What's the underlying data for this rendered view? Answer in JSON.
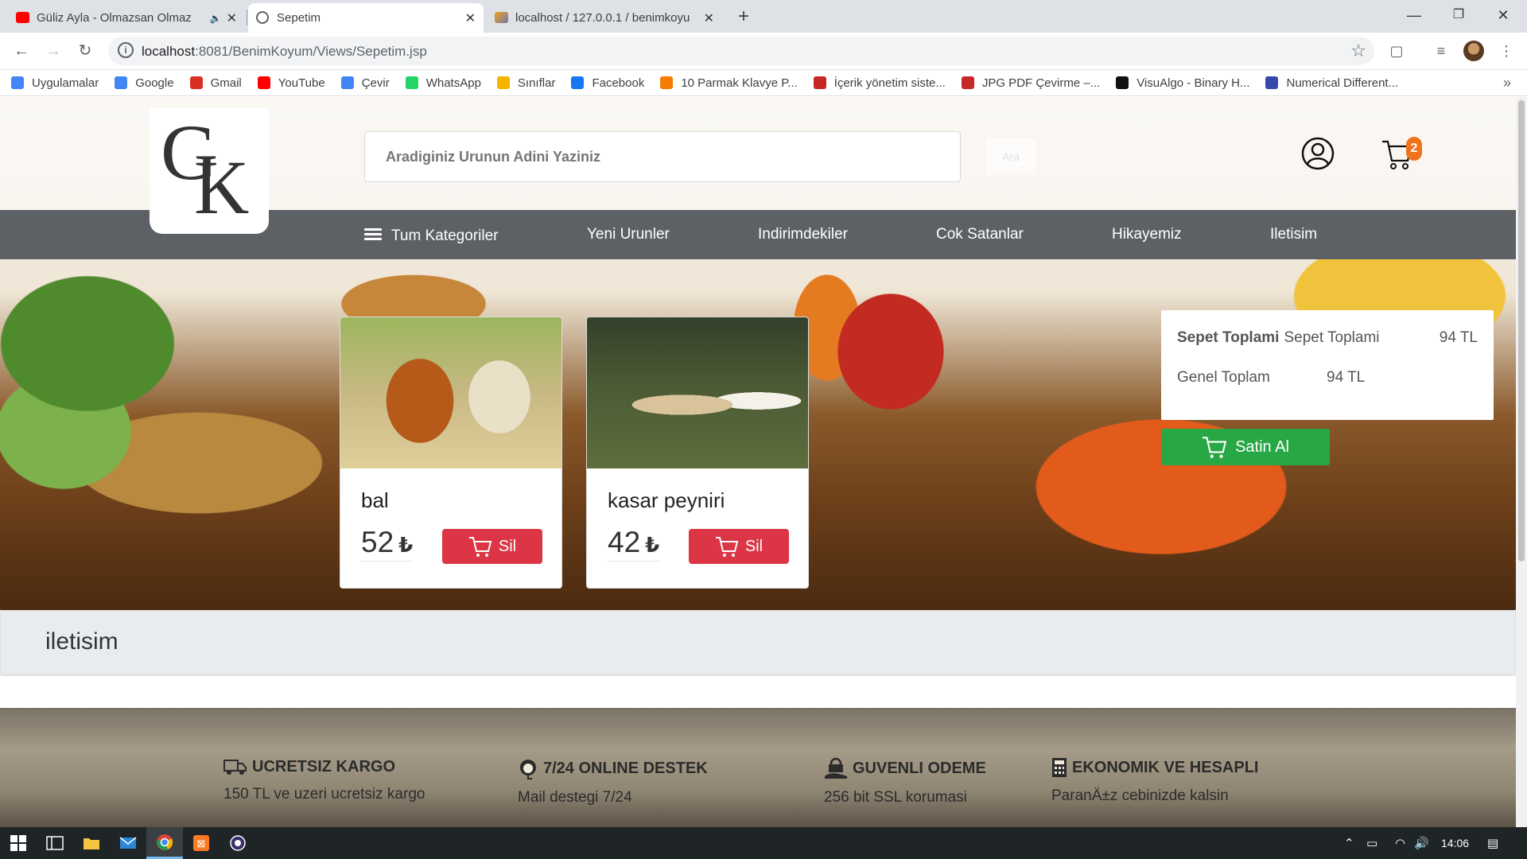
{
  "browser": {
    "tabs": [
      {
        "label": "Güliz Ayla - Olmazsan Olmaz",
        "favicon": "youtube-icon",
        "active": false
      },
      {
        "label": "Sepetim",
        "favicon": "globe-icon",
        "active": true
      },
      {
        "label": "localhost / 127.0.0.1 / benimkoyu",
        "favicon": "phpmyadmin-icon",
        "active": false
      }
    ],
    "url_host": "localhost",
    "url_path": ":8081/BenimKoyum/Views/Sepetim.jsp",
    "bookmarks": [
      {
        "label": "Uygulamalar",
        "icon": "apps-grid-icon",
        "color": "#4285f4"
      },
      {
        "label": "Google",
        "icon": "google-icon",
        "color": "#4285f4"
      },
      {
        "label": "Gmail",
        "icon": "gmail-icon",
        "color": "#d93025"
      },
      {
        "label": "YouTube",
        "icon": "youtube-icon",
        "color": "#ff0000"
      },
      {
        "label": "Çevir",
        "icon": "translate-icon",
        "color": "#4285f4"
      },
      {
        "label": "WhatsApp",
        "icon": "whatsapp-icon",
        "color": "#25d366"
      },
      {
        "label": "Sınıflar",
        "icon": "classroom-icon",
        "color": "#f4b400"
      },
      {
        "label": "Facebook",
        "icon": "facebook-icon",
        "color": "#1877f2"
      },
      {
        "label": "10 Parmak Klavye P...",
        "icon": "keyboard-icon",
        "color": "#f57c00"
      },
      {
        "label": "İçerik yönetim siste...",
        "icon": "cms-icon",
        "color": "#c62828"
      },
      {
        "label": "JPG PDF Çevirme –...",
        "icon": "pdf-icon",
        "color": "#c62828"
      },
      {
        "label": "VisuAlgo - Binary H...",
        "icon": "visualgo-icon",
        "color": "#111111"
      },
      {
        "label": "Numerical Different...",
        "icon": "atom-icon",
        "color": "#3949ab"
      }
    ]
  },
  "site": {
    "logo_letters": {
      "g": "G",
      "k": "K"
    },
    "search_placeholder": "Aradiginiz Urunun Adini Yaziniz",
    "search_button": "Ara",
    "cart_count": "2",
    "nav": [
      "Tum Kategoriler",
      "Yeni Urunler",
      "Indirimdekiler",
      "Cok Satanlar",
      "Hikayemiz",
      "Iletisim"
    ],
    "cart_items": [
      {
        "name": "bal",
        "price": "52",
        "currency": "₺",
        "delete_label": "Sil",
        "image": "honey-jar-image"
      },
      {
        "name": "kasar peyniri",
        "price": "42",
        "currency": "₺",
        "delete_label": "Sil",
        "image": "cheese-on-grass-image"
      }
    ],
    "summary": {
      "subtotal_label_bold": "Sepet Toplami",
      "subtotal_label": "Sepet Toplami",
      "subtotal_value": "94 TL",
      "total_label": "Genel Toplam",
      "total_value": "94 TL"
    },
    "buy_label": "Satin Al",
    "contact_title": "iletisim",
    "features": [
      {
        "title": "UCRETSIZ KARGO",
        "desc": "150 TL ve uzeri ucretsiz kargo",
        "icon": "truck-icon"
      },
      {
        "title": "7/24 ONLINE DESTEK",
        "desc": "Mail destegi 7/24",
        "icon": "headset-icon"
      },
      {
        "title": "GUVENLI ODEME",
        "desc": "256 bit SSL korumasi",
        "icon": "secure-payment-icon"
      },
      {
        "title": "EKONOMIK VE HESAPLI",
        "desc": "ParanÄ±z cebinizde kalsin",
        "icon": "calculator-icon"
      }
    ],
    "colors": {
      "navbar": "#5d6166",
      "delete": "#dc3545",
      "buy": "#28a745",
      "badge": "#f0731e"
    }
  },
  "taskbar": {
    "time": "14:06"
  }
}
